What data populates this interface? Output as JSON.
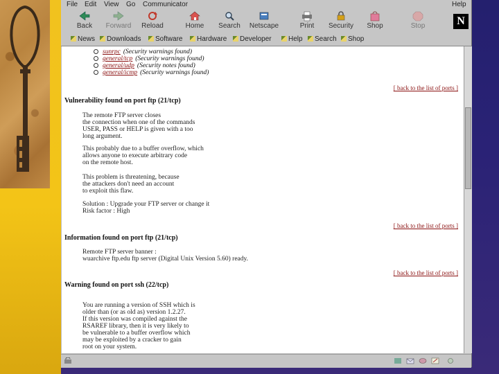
{
  "menu": {
    "file": "File",
    "edit": "Edit",
    "view": "View",
    "go": "Go",
    "communicator": "Communicator",
    "help": "Help"
  },
  "toolbar": {
    "back": "Back",
    "forward": "Forward",
    "reload": "Reload",
    "home": "Home",
    "search": "Search",
    "netscape": "Netscape",
    "print": "Print",
    "security": "Security",
    "shop": "Shop",
    "stop": "Stop",
    "logo": "N"
  },
  "bookmarks": [
    "News",
    "Downloads",
    "Software",
    "Hardware",
    "Developer",
    "Help",
    "Search",
    "Shop"
  ],
  "report": {
    "port_list": [
      {
        "link": "sunrpc",
        "note": "(Security warnings found)"
      },
      {
        "link": "general/tcp",
        "note": "(Security warnings found)"
      },
      {
        "link": "general/udp",
        "note": "(Security notes found)"
      },
      {
        "link": "general/icmp",
        "note": "(Security warnings found)"
      }
    ],
    "back_link": "[ back to the list of ports ]",
    "sections": [
      {
        "title": "Vulnerability found on port ftp (21/tcp)",
        "paragraphs": [
          [
            "The remote FTP server closes",
            "the connection when one of the commands",
            "USER, PASS or HELP is given with a too",
            "long argument."
          ],
          [
            "This probably due to a buffer overflow, which",
            "allows anyone to execute arbitrary code",
            "on the remote host."
          ],
          [
            "This problem is threatening, because",
            "the attackers don't need an account",
            "to exploit this flaw."
          ],
          [
            "Solution : Upgrade your FTP server or change it",
            "Risk factor : High"
          ]
        ]
      },
      {
        "title": "Information found on port ftp (21/tcp)",
        "paragraphs": [
          [
            "Remote FTP server banner :",
            "wuarchive ftp.edu ftp server (Digital Unix Version 5.60) ready."
          ]
        ]
      },
      {
        "title": "Warning found on port ssh (22/tcp)",
        "paragraphs": [
          [
            "You are running a version of SSH which is",
            "older than (or as old as) version 1.2.27.",
            "If this version was compiled against the",
            "RSAREF library, then it is very likely to",
            "be vulnerable to a buffer overflow which",
            "may be exploited by a cracker to gain",
            "root on your system."
          ]
        ]
      }
    ]
  }
}
